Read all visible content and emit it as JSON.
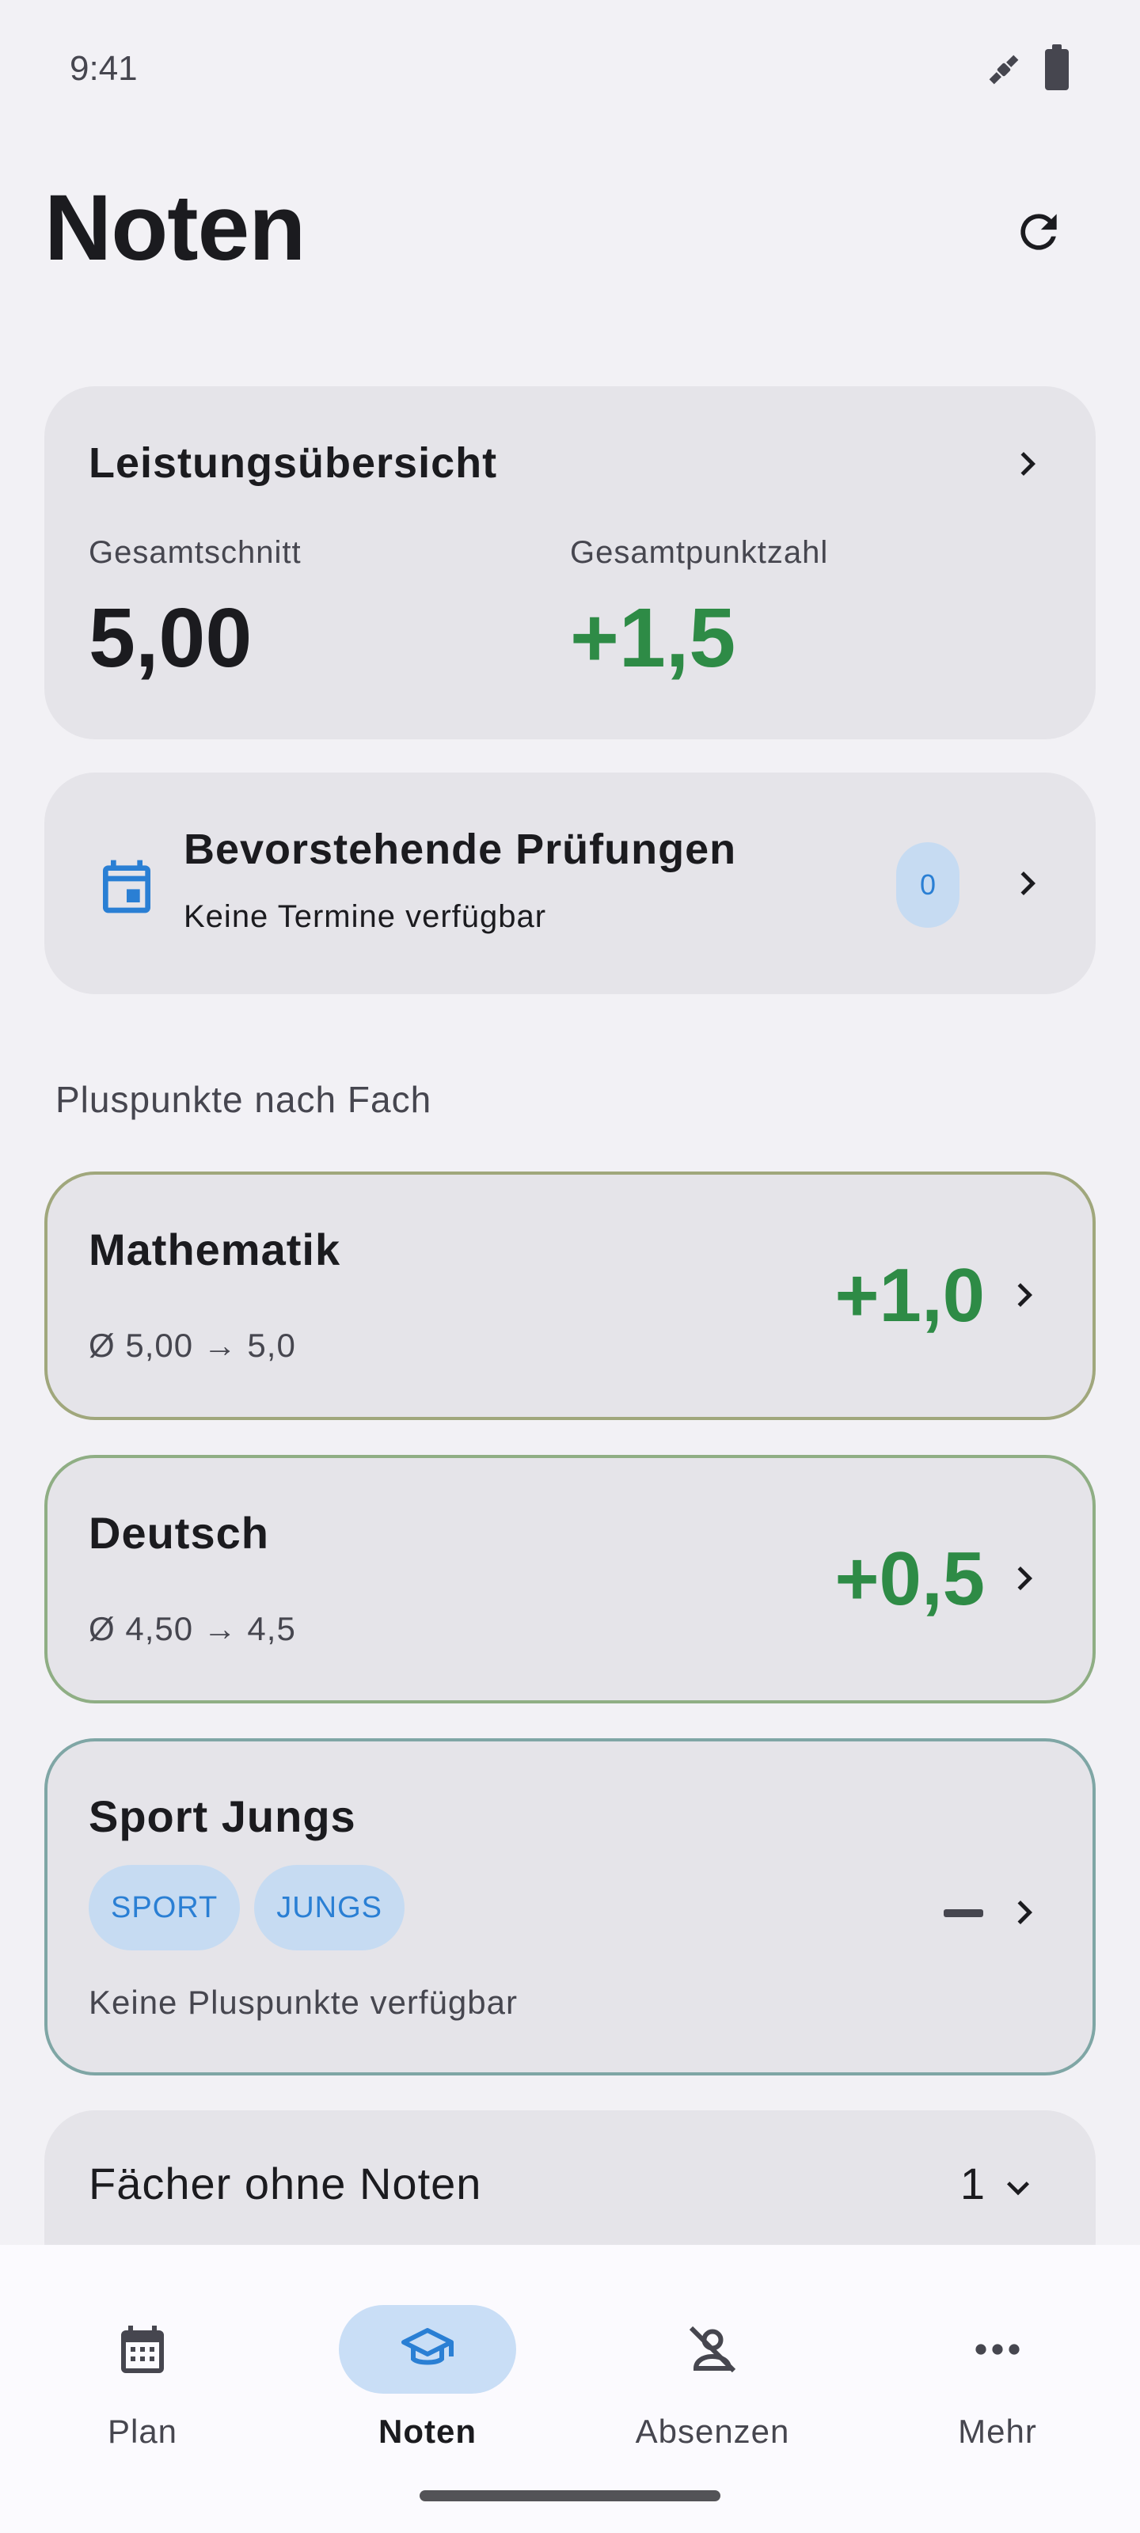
{
  "status_bar": {
    "time": "9:41",
    "icons": [
      "satellite-icon",
      "battery-icon"
    ]
  },
  "header": {
    "title": "Noten",
    "refresh_icon": "refresh-icon"
  },
  "overview": {
    "title": "Leistungsübersicht",
    "avg_label": "Gesamtschnitt",
    "avg_value": "5,00",
    "points_label": "Gesamtpunktzahl",
    "points_value": "+1,5"
  },
  "exams": {
    "title": "Bevorstehende Prüfungen",
    "subtitle": "Keine Termine verfügbar",
    "count": "0"
  },
  "section_label": "Pluspunkte nach Fach",
  "subjects": [
    {
      "name": "Mathematik",
      "avg": "Ø 5,00 → 5,0",
      "points": "+1,0"
    },
    {
      "name": "Deutsch",
      "avg": "Ø 4,50 → 4,5",
      "points": "+0,5"
    },
    {
      "name": "Sport Jungs",
      "tags": [
        "SPORT",
        "JUNGS"
      ],
      "note": "Keine Pluspunkte verfügbar"
    }
  ],
  "no_grades": {
    "label": "Fächer ohne Noten",
    "count": "1"
  },
  "nav": [
    {
      "label": "Plan",
      "icon": "calendar-icon"
    },
    {
      "label": "Noten",
      "icon": "graduation-cap-icon",
      "active": true
    },
    {
      "label": "Absenzen",
      "icon": "person-off-icon"
    },
    {
      "label": "Mehr",
      "icon": "more-horizontal-icon"
    }
  ],
  "colors": {
    "positive": "#2e8b46",
    "accent": "#2a7fd4",
    "card": "#e5e4e9",
    "background": "#f2f1f5"
  }
}
